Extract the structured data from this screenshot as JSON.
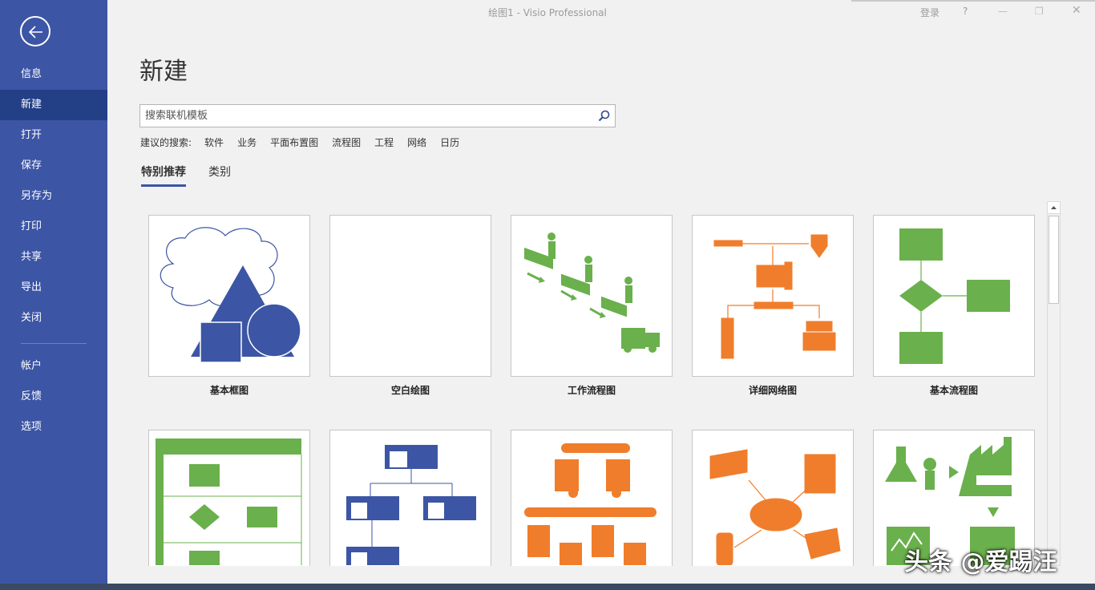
{
  "window": {
    "title": "绘图1  -  Visio Professional",
    "login": "登录",
    "help": "?",
    "minimize": "—",
    "restore": "❐",
    "close": "✕"
  },
  "sidebar": {
    "items": [
      {
        "label": "信息"
      },
      {
        "label": "新建"
      },
      {
        "label": "打开"
      },
      {
        "label": "保存"
      },
      {
        "label": "另存为"
      },
      {
        "label": "打印"
      },
      {
        "label": "共享"
      },
      {
        "label": "导出"
      },
      {
        "label": "关闭"
      },
      {
        "label": "帐户"
      },
      {
        "label": "反馈"
      },
      {
        "label": "选项"
      }
    ],
    "active": "新建"
  },
  "main": {
    "title": "新建",
    "search": {
      "placeholder": "搜索联机模板",
      "value": ""
    },
    "suggested_label": "建议的搜索:",
    "suggested": [
      "软件",
      "业务",
      "平面布置图",
      "流程图",
      "工程",
      "网络",
      "日历"
    ],
    "tabs": [
      {
        "label": "特别推荐",
        "active": true
      },
      {
        "label": "类别",
        "active": false
      }
    ],
    "templates_row1": [
      {
        "label": "基本框图"
      },
      {
        "label": "空白绘图"
      },
      {
        "label": "工作流程图"
      },
      {
        "label": "详细网络图"
      },
      {
        "label": "基本流程图"
      }
    ]
  },
  "watermark": "头条 @爱踢汪",
  "colors": {
    "sidebar": "#3c55a5",
    "sidebar_active": "#233f86",
    "blue": "#3c55a5",
    "green": "#6ab04c",
    "orange": "#f07d2b"
  }
}
